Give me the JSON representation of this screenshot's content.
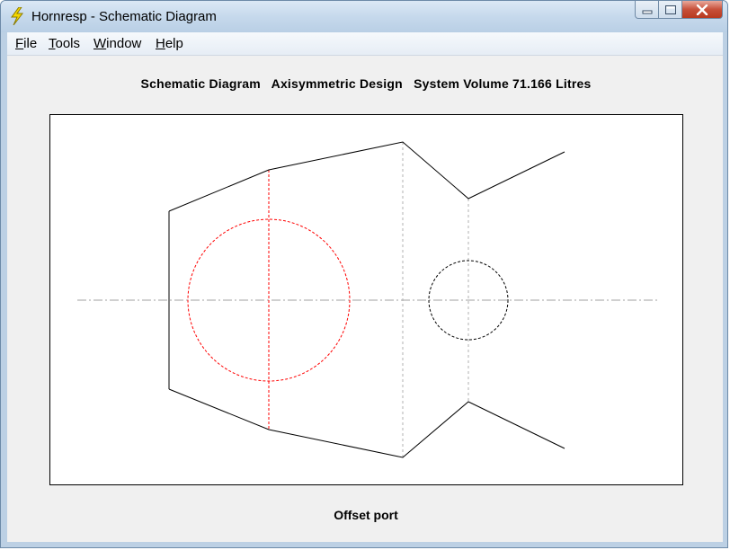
{
  "window": {
    "title": "Hornresp - Schematic Diagram",
    "icon": "lightning-bolt-icon",
    "caption_buttons": [
      "minimize-icon",
      "maximize-icon",
      "close-icon"
    ]
  },
  "menu": {
    "items": [
      {
        "accel": "F",
        "rest": "ile"
      },
      {
        "accel": "T",
        "rest": "ools"
      },
      {
        "accel": "W",
        "rest": "indow"
      },
      {
        "accel": "H",
        "rest": "elp"
      }
    ]
  },
  "diagram": {
    "header": "Schematic Diagram   Axisymmetric Design   System Volume 71.166 Litres",
    "footer": "Offset port",
    "colors": {
      "outline": "#000000",
      "driver": "#ff0000",
      "port": "#000000",
      "segment_divider": "#b0b0b0",
      "axis": "#a0a0a0",
      "canvas_bg": "#ffffff",
      "client_bg": "#f0f0f0"
    }
  }
}
